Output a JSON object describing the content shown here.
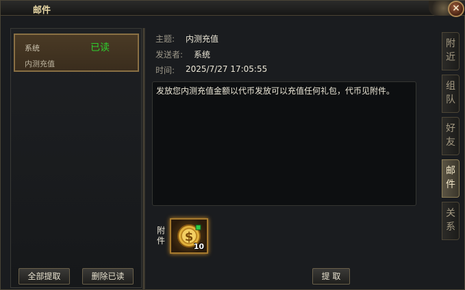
{
  "window": {
    "title": "邮件",
    "close_symbol": "×"
  },
  "mail_list": [
    {
      "sender": "系统",
      "status": "已读",
      "subject": "内测充值",
      "selected": true
    }
  ],
  "buttons": {
    "claim_all": "全部提取",
    "delete_read": "删除已读",
    "claim": "提 取"
  },
  "detail": {
    "subject_label": "主题:",
    "subject": "内测充值",
    "sender_label": "发送者:",
    "sender": "系统",
    "time_label": "时间:",
    "time": "2025/7/27 17:05:55",
    "body": "发放您内测充值金额以代币发放可以充值任何礼包，代币见附件。",
    "attachment_label": "附件",
    "attachment": {
      "icon": "coin-icon",
      "count": "10"
    }
  },
  "tabs": [
    {
      "label": "附近",
      "active": false
    },
    {
      "label": "组队",
      "active": false
    },
    {
      "label": "好友",
      "active": false
    },
    {
      "label": "邮件",
      "active": true
    },
    {
      "label": "关系",
      "active": false
    }
  ],
  "colors": {
    "status_read": "#2ed12e",
    "accent_gold": "#a67a2e"
  }
}
